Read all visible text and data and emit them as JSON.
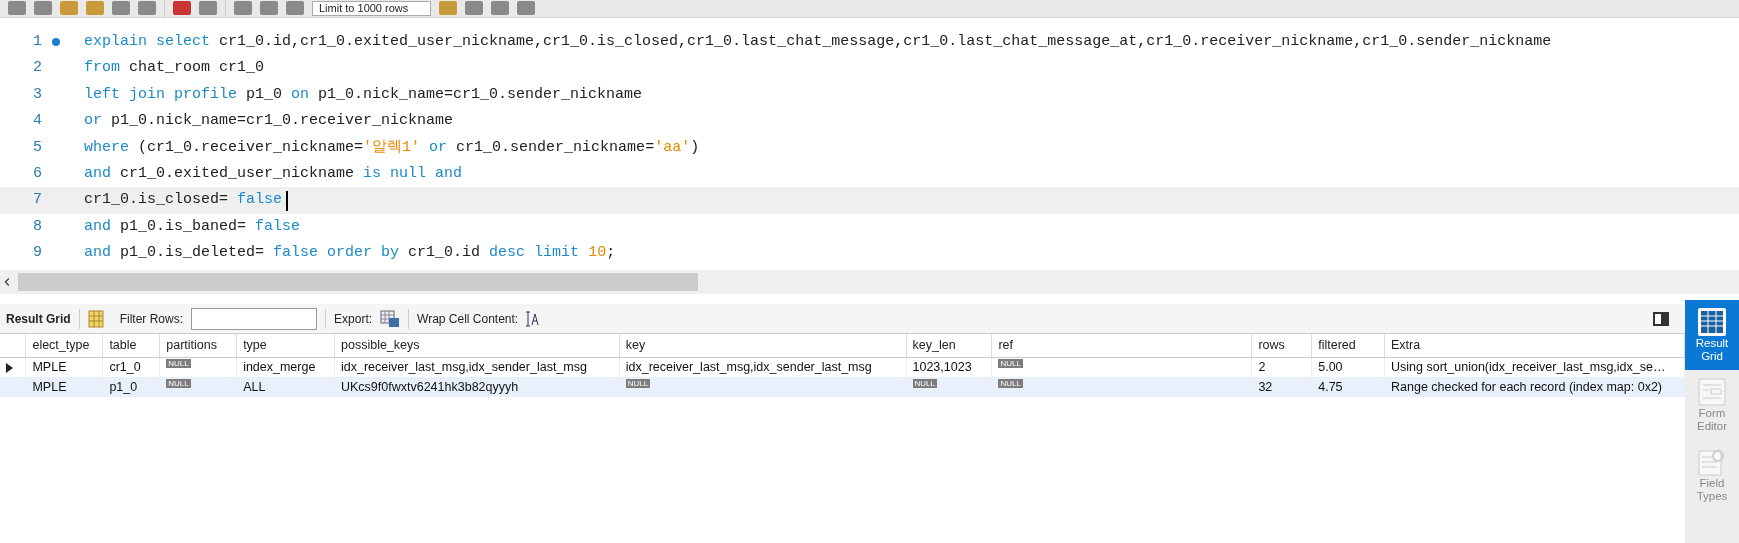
{
  "toolbar": {
    "limit": "Limit to 1000 rows"
  },
  "editor": {
    "lines": [
      {
        "number": "1",
        "marker": true,
        "current": false,
        "tokens": [
          {
            "kind": "kw",
            "text": "explain select"
          },
          {
            "kind": "id",
            "text": " cr1_0.id,cr1_0.exited_user_nickname,cr1_0.is_closed,cr1_0.last_chat_message,cr1_0.last_chat_message_at,cr1_0.receiver_nickname,cr1_0.sender_nickname"
          }
        ]
      },
      {
        "number": "2",
        "marker": false,
        "current": false,
        "tokens": [
          {
            "kind": "kw",
            "text": "from"
          },
          {
            "kind": "id",
            "text": " chat_room cr1_0"
          }
        ]
      },
      {
        "number": "3",
        "marker": false,
        "current": false,
        "tokens": [
          {
            "kind": "kw",
            "text": "left join profile"
          },
          {
            "kind": "id",
            "text": " p1_0 "
          },
          {
            "kind": "kw",
            "text": "on"
          },
          {
            "kind": "id",
            "text": " p1_0.nick_name=cr1_0.sender_nickname"
          }
        ]
      },
      {
        "number": "4",
        "marker": false,
        "current": false,
        "tokens": [
          {
            "kind": "kw",
            "text": "or"
          },
          {
            "kind": "id",
            "text": " p1_0.nick_name=cr1_0.receiver_nickname"
          }
        ]
      },
      {
        "number": "5",
        "marker": false,
        "current": false,
        "tokens": [
          {
            "kind": "kw",
            "text": "where"
          },
          {
            "kind": "id",
            "text": " (cr1_0.receiver_nickname="
          },
          {
            "kind": "str",
            "text": "'알렉1'"
          },
          {
            "kind": "kw",
            "text": " or"
          },
          {
            "kind": "id",
            "text": " cr1_0.sender_nickname="
          },
          {
            "kind": "str",
            "text": "'aa'"
          },
          {
            "kind": "id",
            "text": ")"
          }
        ]
      },
      {
        "number": "6",
        "marker": false,
        "current": false,
        "tokens": [
          {
            "kind": "kw",
            "text": "and"
          },
          {
            "kind": "id",
            "text": " cr1_0.exited_user_nickname "
          },
          {
            "kind": "kw",
            "text": "is null and"
          }
        ]
      },
      {
        "number": "7",
        "marker": false,
        "current": true,
        "tokens": [
          {
            "kind": "id",
            "text": "cr1_0.is_closed= "
          },
          {
            "kind": "kw",
            "text": "false"
          }
        ]
      },
      {
        "number": "8",
        "marker": false,
        "current": false,
        "tokens": [
          {
            "kind": "kw",
            "text": "and"
          },
          {
            "kind": "id",
            "text": " p1_0.is_baned= "
          },
          {
            "kind": "kw",
            "text": "false"
          }
        ]
      },
      {
        "number": "9",
        "marker": false,
        "current": false,
        "tokens": [
          {
            "kind": "kw",
            "text": "and"
          },
          {
            "kind": "id",
            "text": " p1_0.is_deleted= "
          },
          {
            "kind": "kw",
            "text": "false order by"
          },
          {
            "kind": "id",
            "text": " cr1_0.id "
          },
          {
            "kind": "kw",
            "text": "desc limit "
          },
          {
            "kind": "num",
            "text": "10"
          },
          {
            "kind": "id",
            "text": ";"
          }
        ]
      }
    ]
  },
  "result_toolbar": {
    "title": "Result Grid",
    "filter_label": "Filter Rows:",
    "export_label": "Export:",
    "wrap_label": "Wrap Cell Content:"
  },
  "table": {
    "columns": [
      "elect_type",
      "table",
      "partitions",
      "type",
      "possible_keys",
      "key",
      "key_len",
      "ref",
      "rows",
      "filtered",
      "Extra"
    ],
    "rows": [
      {
        "current": true,
        "cells": [
          {
            "text": "MPLE",
            "null": false
          },
          {
            "text": "cr1_0",
            "null": false
          },
          {
            "text": "NULL",
            "null": true
          },
          {
            "text": "index_merge",
            "null": false
          },
          {
            "text": "idx_receiver_last_msg,idx_sender_last_msg",
            "null": false
          },
          {
            "text": "idx_receiver_last_msg,idx_sender_last_msg",
            "null": false
          },
          {
            "text": "1023,1023",
            "null": false
          },
          {
            "text": "NULL",
            "null": true
          },
          {
            "text": "2",
            "null": false
          },
          {
            "text": "5.00",
            "null": false
          },
          {
            "text": "Using sort_union(idx_receiver_last_msg,idx_se…",
            "null": false
          }
        ]
      },
      {
        "current": false,
        "cells": [
          {
            "text": "MPLE",
            "null": false
          },
          {
            "text": "p1_0",
            "null": false
          },
          {
            "text": "NULL",
            "null": true
          },
          {
            "text": "ALL",
            "null": false
          },
          {
            "text": "UKcs9f0fwxtv6241hk3b82qyyyh",
            "null": false
          },
          {
            "text": "NULL",
            "null": true
          },
          {
            "text": "NULL",
            "null": true
          },
          {
            "text": "NULL",
            "null": true
          },
          {
            "text": "32",
            "null": false
          },
          {
            "text": "4.75",
            "null": false
          },
          {
            "text": "Range checked for each record (index map: 0x2)",
            "null": false
          }
        ]
      }
    ]
  },
  "side_panel": [
    {
      "label": "Result Grid",
      "selected": true
    },
    {
      "label": "Form Editor",
      "selected": false
    },
    {
      "label": "Field Types",
      "selected": false
    }
  ]
}
